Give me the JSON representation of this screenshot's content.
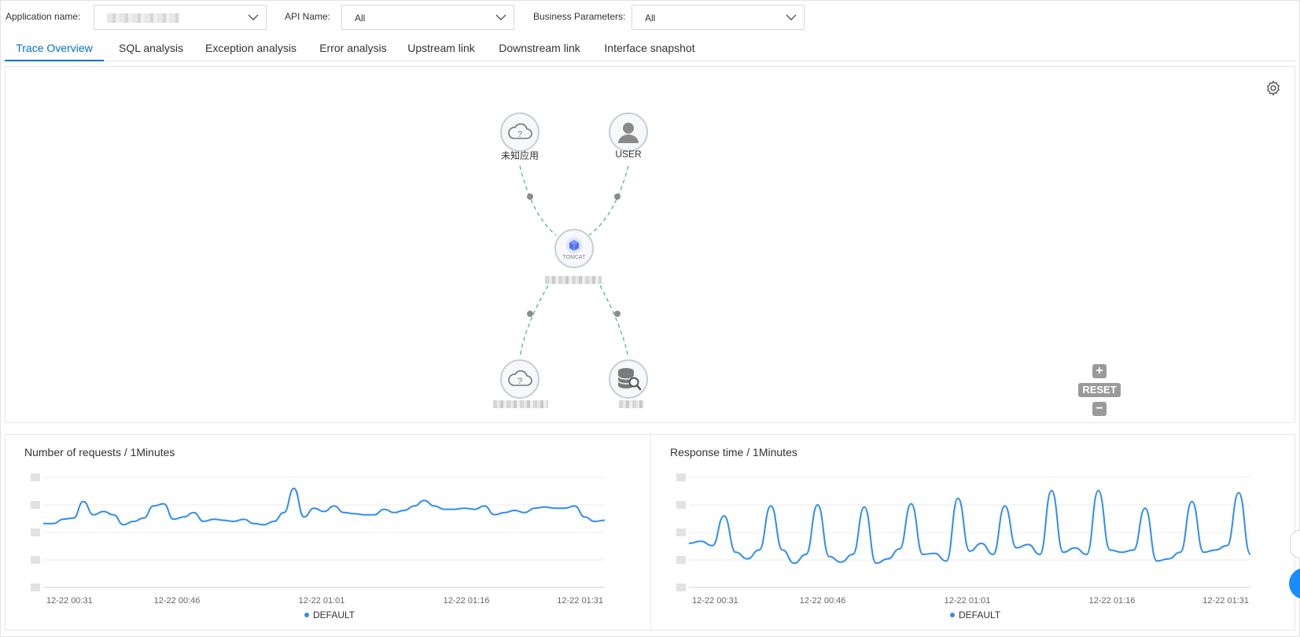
{
  "filters": {
    "app_label": "Application name:",
    "api_label": "API Name:",
    "api_value": "All",
    "biz_label": "Business Parameters:",
    "biz_value": "All"
  },
  "tabs": [
    {
      "label": "Trace Overview",
      "active": true
    },
    {
      "label": "SQL analysis"
    },
    {
      "label": "Exception analysis"
    },
    {
      "label": "Error analysis"
    },
    {
      "label": "Upstream link"
    },
    {
      "label": "Downstream link"
    },
    {
      "label": "Interface snapshot"
    }
  ],
  "topology": {
    "nodes": [
      {
        "label": "未知应用",
        "icon": "cloud-question-icon"
      },
      {
        "label": "USER",
        "icon": "user-icon"
      },
      {
        "label": "TOMCAT",
        "icon": "tomcat-cube-icon"
      },
      {
        "label": "",
        "icon": "cloud-question-icon"
      },
      {
        "label": "",
        "icon": "database-search-icon"
      }
    ],
    "reset_label": "RESET",
    "zoom_in_label": "+",
    "zoom_out_label": "−"
  },
  "colors": {
    "accent": "#0070cc",
    "series": "#2f8df0",
    "link": "#3db28d",
    "node_border": "#c8ccd6"
  },
  "charts": {
    "requests": {
      "title": "Number of requests / 1Minutes",
      "legend": "DEFAULT"
    },
    "response": {
      "title": "Response time / 1Minutes",
      "legend": "DEFAULT"
    }
  },
  "chart_data": [
    {
      "type": "line",
      "title": "Number of requests / 1Minutes",
      "x_ticks": [
        "12-22 00:31",
        "12-22 00:46",
        "12-22 01:01",
        "12-22 01:16",
        "12-22 01:31"
      ],
      "series": [
        {
          "name": "DEFAULT",
          "values": [
            0.58,
            0.58,
            0.62,
            0.63,
            0.78,
            0.66,
            0.69,
            0.66,
            0.57,
            0.6,
            0.63,
            0.74,
            0.76,
            0.62,
            0.64,
            0.68,
            0.6,
            0.62,
            0.61,
            0.6,
            0.62,
            0.58,
            0.57,
            0.6,
            0.68,
            0.9,
            0.64,
            0.72,
            0.69,
            0.74,
            0.68,
            0.67,
            0.66,
            0.66,
            0.71,
            0.68,
            0.7,
            0.74,
            0.79,
            0.74,
            0.71,
            0.71,
            0.72,
            0.71,
            0.74,
            0.66,
            0.68,
            0.7,
            0.68,
            0.72,
            0.73,
            0.72,
            0.72,
            0.74,
            0.64,
            0.6,
            0.61
          ]
        }
      ]
    },
    {
      "type": "line",
      "title": "Response time / 1Minutes",
      "x_ticks": [
        "12-22 00:31",
        "12-22 00:46",
        "12-22 01:01",
        "12-22 01:16",
        "12-22 01:31"
      ],
      "series": [
        {
          "name": "DEFAULT",
          "values": [
            0.4,
            0.42,
            0.38,
            0.65,
            0.32,
            0.26,
            0.34,
            0.74,
            0.34,
            0.22,
            0.3,
            0.75,
            0.28,
            0.23,
            0.3,
            0.73,
            0.22,
            0.26,
            0.35,
            0.76,
            0.3,
            0.31,
            0.24,
            0.81,
            0.33,
            0.4,
            0.3,
            0.74,
            0.36,
            0.39,
            0.3,
            0.88,
            0.32,
            0.36,
            0.3,
            0.88,
            0.34,
            0.32,
            0.34,
            0.72,
            0.24,
            0.26,
            0.32,
            0.78,
            0.32,
            0.34,
            0.38,
            0.86,
            0.3
          ]
        }
      ]
    }
  ]
}
